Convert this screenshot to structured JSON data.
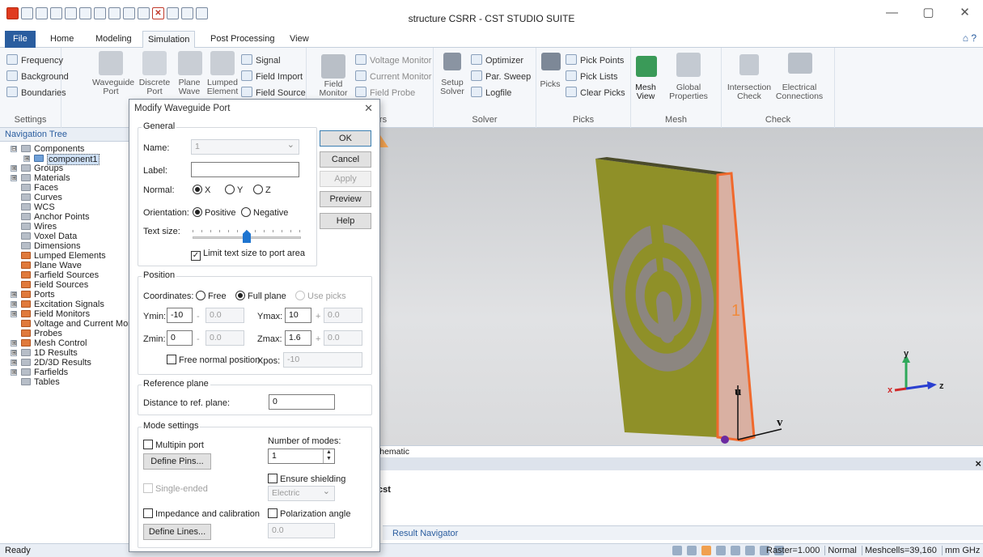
{
  "window": {
    "title": "structure CSRR - CST STUDIO SUITE",
    "controls": [
      "—",
      "▢",
      "✕"
    ]
  },
  "tabs": [
    "File",
    "Home",
    "Modeling",
    "Simulation",
    "Post Processing",
    "View"
  ],
  "help_symbol": "⌂ ?",
  "ribbon": {
    "settings": {
      "label": "Settings",
      "items": [
        "Frequency",
        "Background",
        "Boundaries"
      ]
    },
    "sources": {
      "waveguide_port": "Waveguide\nPort",
      "discrete_port": "Discrete\nPort",
      "plane_wave": "Plane\nWave",
      "lumped_element": "Lumped\nElement",
      "signal": "Signal",
      "field_import": "Field Import",
      "field_source": "Field Source"
    },
    "monitors": {
      "label": "Monitors",
      "field_monitor": "Field\nMonitor",
      "items": [
        "Voltage Monitor",
        "Current Monitor",
        "Field Probe"
      ]
    },
    "solver": {
      "label": "Solver",
      "setup": "Setup\nSolver",
      "items": [
        "Optimizer",
        "Par. Sweep",
        "Logfile"
      ]
    },
    "picks": {
      "label": "Picks",
      "big": "Picks",
      "items": [
        "Pick Points",
        "Pick Lists",
        "Clear Picks"
      ]
    },
    "mesh": {
      "label": "Mesh",
      "mesh_view": "Mesh\nView",
      "global_properties": "Global\nProperties"
    },
    "check": {
      "label": "Check",
      "intersection": "Intersection\nCheck",
      "electrical": "Electrical\nConnections"
    }
  },
  "nav": {
    "header": "Navigation Tree",
    "items": [
      {
        "label": "Components",
        "exp": "⊟",
        "icon": "gray"
      },
      {
        "label": "component1",
        "exp": "⊞",
        "icon": "blue",
        "child": true
      },
      {
        "label": "Groups",
        "exp": "⊞",
        "icon": "gray"
      },
      {
        "label": "Materials",
        "exp": "⊞",
        "icon": "gray"
      },
      {
        "label": "Faces",
        "icon": "gray"
      },
      {
        "label": "Curves",
        "icon": "gray"
      },
      {
        "label": "WCS",
        "icon": "gray"
      },
      {
        "label": "Anchor Points",
        "icon": "gray"
      },
      {
        "label": "Wires",
        "icon": "gray"
      },
      {
        "label": "Voxel Data",
        "icon": "gray"
      },
      {
        "label": "Dimensions",
        "icon": "gray"
      },
      {
        "label": "Lumped Elements",
        "icon": "red"
      },
      {
        "label": "Plane Wave",
        "icon": "red"
      },
      {
        "label": "Farfield Sources",
        "icon": "red"
      },
      {
        "label": "Field Sources",
        "icon": "red"
      },
      {
        "label": "Ports",
        "exp": "⊞",
        "icon": "red"
      },
      {
        "label": "Excitation Signals",
        "exp": "⊞",
        "icon": "red"
      },
      {
        "label": "Field Monitors",
        "exp": "⊞",
        "icon": "red"
      },
      {
        "label": "Voltage and Current Monito",
        "icon": "red"
      },
      {
        "label": "Probes",
        "icon": "red"
      },
      {
        "label": "Mesh Control",
        "exp": "⊞",
        "icon": "red"
      },
      {
        "label": "1D Results",
        "exp": "⊞",
        "icon": "gray"
      },
      {
        "label": "2D/3D Results",
        "exp": "⊞",
        "icon": "gray"
      },
      {
        "label": "Farfields",
        "exp": "⊞",
        "icon": "gray"
      },
      {
        "label": "Tables",
        "icon": "gray"
      }
    ]
  },
  "dialog": {
    "title": "Modify Waveguide Port",
    "close": "✕",
    "general": {
      "legend": "General",
      "name_label": "Name:",
      "name_value": "1",
      "label_label": "Label:",
      "label_value": "",
      "normal_label": "Normal:",
      "normal_options": [
        "X",
        "Y",
        "Z"
      ],
      "orientation_label": "Orientation:",
      "orientation_options": [
        "Positive",
        "Negative"
      ],
      "textsize_label": "Text size:",
      "text_size_fraction": 0.5,
      "limit_label": "Limit text size to port area"
    },
    "buttons": {
      "ok": "OK",
      "cancel": "Cancel",
      "apply": "Apply",
      "preview": "Preview",
      "help": "Help"
    },
    "position": {
      "legend": "Position",
      "coords_label": "Coordinates:",
      "coord_options": [
        "Free",
        "Full plane",
        "Use picks"
      ],
      "ymin_label": "Ymin:",
      "ymin": "-10",
      "ymin_off": "0.0",
      "ymax_label": "Ymax:",
      "ymax": "10",
      "ymax_off": "0.0",
      "zmin_label": "Zmin:",
      "zmin": "0",
      "zmin_off": "0.0",
      "zmax_label": "Zmax:",
      "zmax": "1.6",
      "zmax_off": "0.0",
      "minus": "-",
      "plus": "+",
      "free_normal_label": "Free normal position",
      "xpos_label": "Xpos:",
      "xpos": "-10"
    },
    "reference": {
      "legend": "Reference plane",
      "dist_label": "Distance to ref. plane:",
      "dist_value": "0"
    },
    "mode": {
      "legend": "Mode settings",
      "multipin_label": "Multipin port",
      "define_pins": "Define Pins...",
      "modes_label": "Number of modes:",
      "modes_value": "1",
      "shielding_label": "Ensure shielding",
      "single_ended": "Single-ended",
      "electric": "Electric",
      "impedance_label": "Impedance and calibration",
      "polarization_label": "Polarization angle",
      "define_lines": "Define Lines...",
      "polarization_value": "0.0"
    }
  },
  "viewport": {
    "port_label": "1",
    "u_label": "u",
    "v_label": "v",
    "axis_y": "y",
    "axis_x": "x",
    "axis_z": "z"
  },
  "bottom": {
    "schematic_tab": "chematic",
    "message_close": "×",
    "message_text": "cst",
    "result_navigator": "Result Navigator"
  },
  "status": {
    "ready": "Ready",
    "raster": "Raster=1.000",
    "mode": "Normal",
    "meshcells": "Meshcells=39,160",
    "units": "mm  GHz  ns  K"
  },
  "colors": {
    "file_tab": "#2a5d9f",
    "accent_orange": "#f08a3c",
    "substrate": "#8f9028",
    "metal": "#8c8680"
  }
}
